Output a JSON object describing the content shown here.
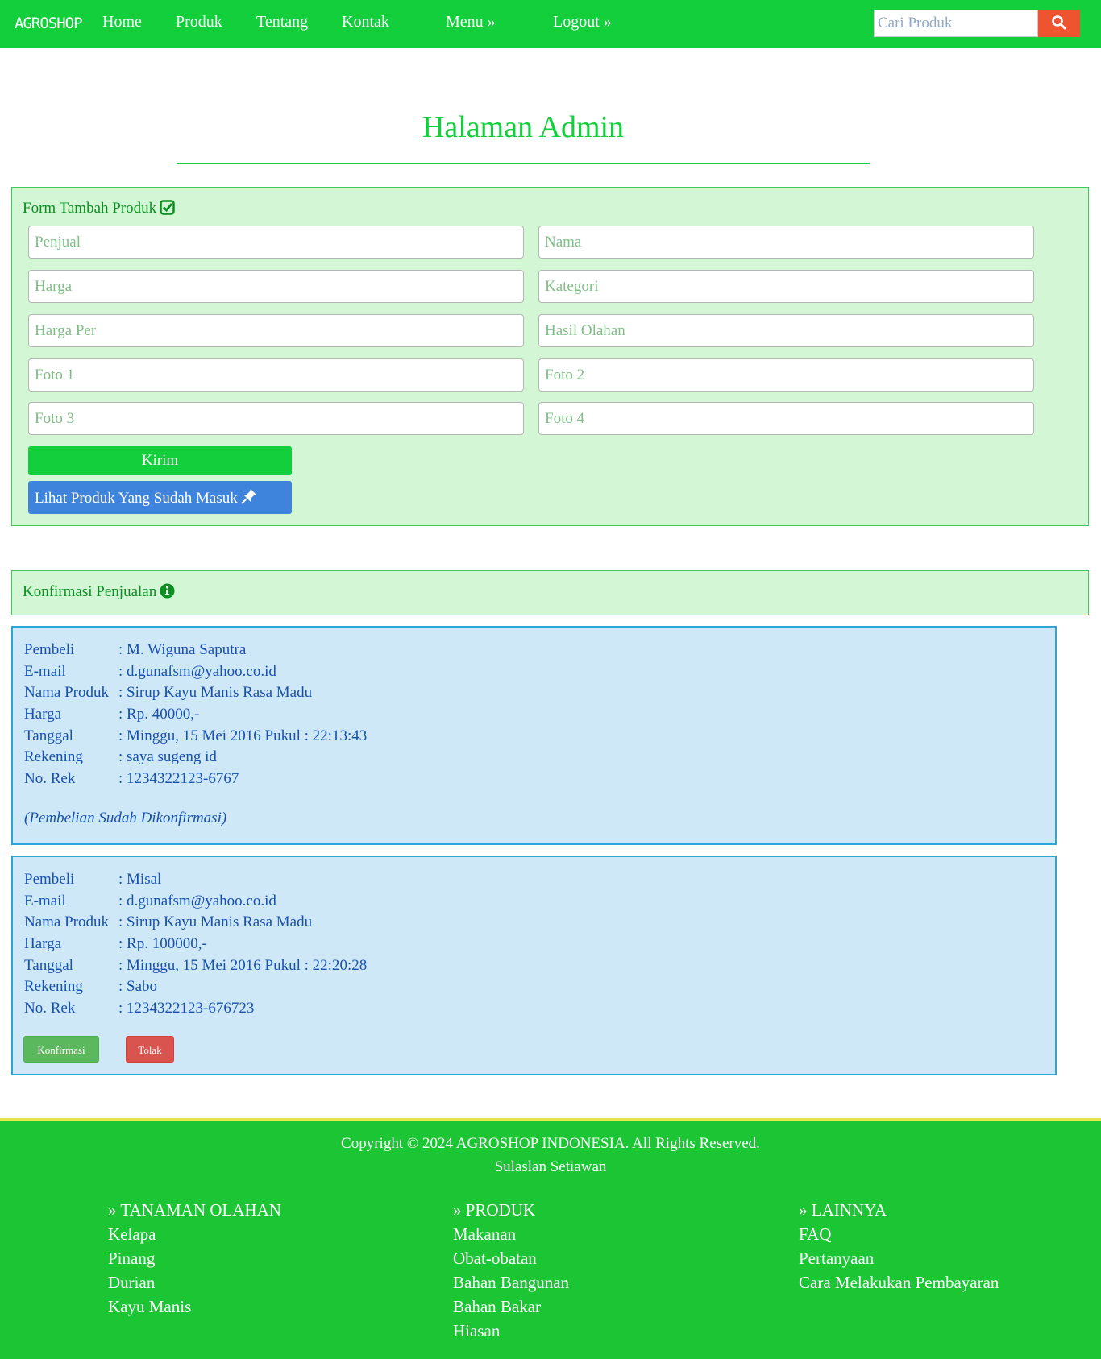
{
  "nav": {
    "brand": "AGROSHOP",
    "links": [
      "Home",
      "Produk",
      "Tentang",
      "Kontak",
      "Menu »",
      "Logout »"
    ],
    "search_placeholder": "Cari Produk"
  },
  "page_title": "Halaman Admin",
  "form": {
    "title": "Form Tambah Produk",
    "fields": [
      "Penjual",
      "Nama",
      "Harga",
      "Kategori",
      "Harga Per",
      "Hasil Olahan",
      "Foto 1",
      "Foto 2",
      "Foto 3",
      "Foto 4"
    ],
    "submit_label": "Kirim",
    "view_label": "Lihat Produk Yang Sudah Masuk"
  },
  "confirm": {
    "title": "Konfirmasi Penjualan",
    "labels": [
      "Pembeli",
      "E-mail",
      "Nama Produk",
      "Harga",
      "Tanggal",
      "Rekening",
      "No. Rek"
    ],
    "orders": [
      {
        "values": [
          ": M. Wiguna Saputra",
          ": d.gunafsm@yahoo.co.id",
          ": Sirup Kayu Manis Rasa Madu",
          ": Rp. 40000,-",
          ": Minggu, 15 Mei 2016 Pukul : 22:13:43",
          ": saya sugeng id",
          ": 1234322123-6767"
        ],
        "status": "(Pembelian Sudah Dikonfirmasi)"
      },
      {
        "values": [
          ": Misal",
          ": d.gunafsm@yahoo.co.id",
          ": Sirup Kayu Manis Rasa Madu",
          ": Rp. 100000,-",
          ": Minggu, 15 Mei 2016 Pukul : 22:20:28",
          ": Sabo",
          ": 1234322123-676723"
        ],
        "confirm_label": "Konfirmasi",
        "reject_label": "Tolak"
      }
    ]
  },
  "footer": {
    "copyright": "Copyright © 2024 AGROSHOP INDONESIA. All Rights Reserved.",
    "author": "Sulaslan Setiawan",
    "columns": [
      {
        "heading": "» TANAMAN OLAHAN",
        "items": [
          "Kelapa",
          "Pinang",
          "Durian",
          "Kayu Manis"
        ]
      },
      {
        "heading": "» PRODUK",
        "items": [
          "Makanan",
          "Obat-obatan",
          "Bahan Bangunan",
          "Bahan Bakar",
          "Hiasan"
        ]
      },
      {
        "heading": "» LAINNYA",
        "items": [
          "FAQ",
          "Pertanyaan",
          "Cara Melakukan Pembayaran"
        ]
      }
    ]
  },
  "colors": {
    "primary_green": "#12cf3b",
    "footer_green": "#1bc534",
    "panel_green": "#d3f7d4",
    "info_blue": "#cfe8f8",
    "button_blue": "#3f84dc",
    "search_orange": "#ee5430",
    "confirm_green": "#5cb85c",
    "reject_red": "#d9534f"
  }
}
